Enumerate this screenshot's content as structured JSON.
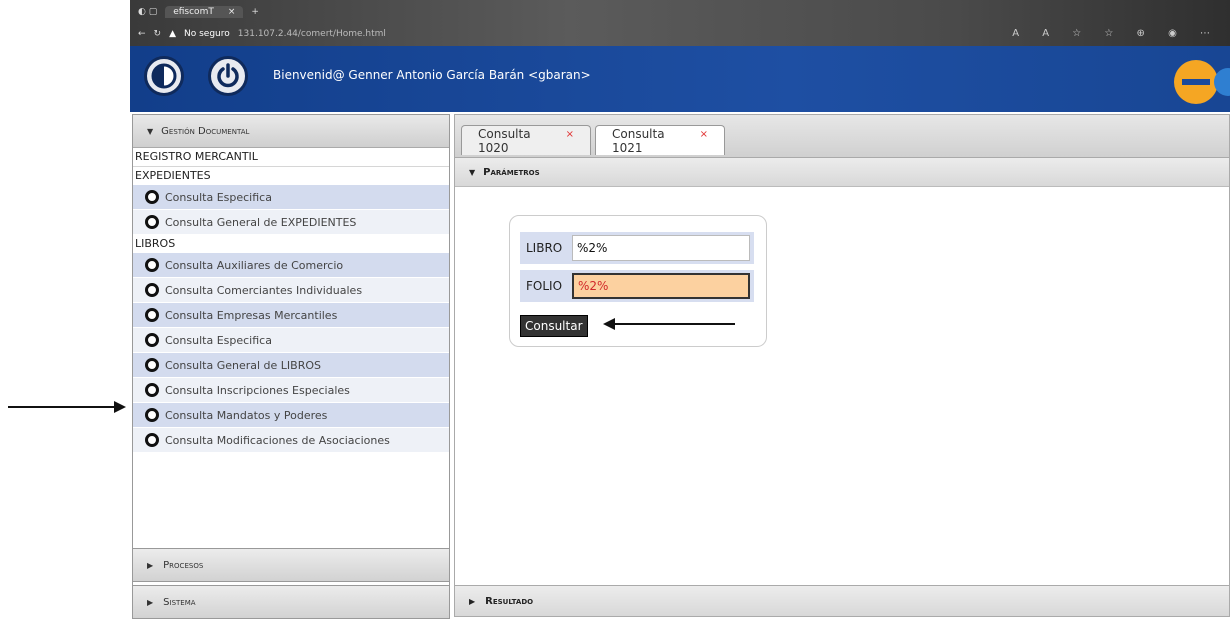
{
  "browser": {
    "tab_title": "efiscomT",
    "tab_close": "×",
    "tab_new": "+",
    "security_warning": "No seguro",
    "url": "131.107.2.44/comert/Home.html"
  },
  "header": {
    "welcome": "Bienvenid@ Genner Antonio García Barán <gbaran>",
    "brand_letter": "e",
    "brand_color": "#f5a623",
    "bg_color": "#1b4a9c"
  },
  "sidebar": {
    "title": "Gestión Documental",
    "registro": "REGISTRO MERCANTIL",
    "expedientes": "EXPEDIENTES",
    "expedientes_items": [
      "Consulta Especifica",
      "Consulta General de EXPEDIENTES"
    ],
    "libros": "LIBROS",
    "libros_items": [
      "Consulta Auxiliares de Comercio",
      "Consulta Comerciantes Individuales",
      "Consulta Empresas Mercantiles",
      "Consulta Especifica",
      "Consulta General de LIBROS",
      "Consulta Inscripciones Especiales",
      "Consulta Mandatos y Poderes",
      "Consulta Modificaciones de Asociaciones"
    ],
    "procesos": "Procesos",
    "sistema": "Sistema"
  },
  "tabs": [
    {
      "label": "Consulta 1020",
      "close": "×"
    },
    {
      "label": "Consulta 1021",
      "close": "×"
    }
  ],
  "parametros": {
    "title": "Parámetros",
    "libro_label": "LIBRO",
    "libro_value": "%2%",
    "folio_label": "FOLIO",
    "folio_value": "%2%",
    "consultar": "Consultar"
  },
  "resultado": {
    "title": "Resultado"
  }
}
